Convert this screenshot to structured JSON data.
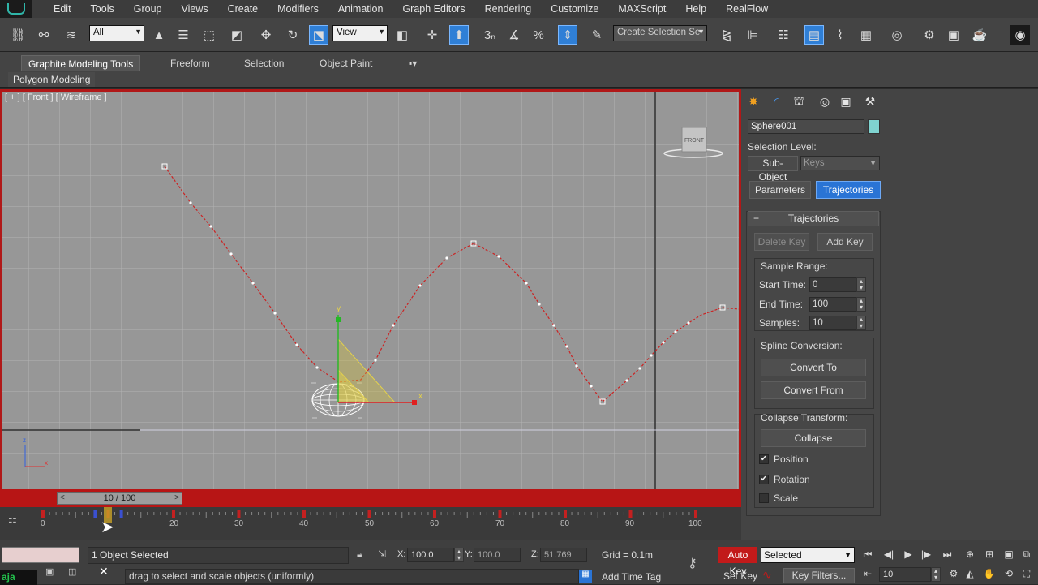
{
  "menubar": {
    "items": [
      "Edit",
      "Tools",
      "Group",
      "Views",
      "Create",
      "Modifiers",
      "Animation",
      "Graph Editors",
      "Rendering",
      "Customize",
      "MAXScript",
      "Help",
      "RealFlow"
    ]
  },
  "toolbar": {
    "selection_filter": "All",
    "reference_coord": "View",
    "named_selection_placeholder": "Create Selection Se"
  },
  "ribbon": {
    "tabs": [
      "Graphite Modeling Tools",
      "Freeform",
      "Selection",
      "Object Paint"
    ],
    "active_tab": "Graphite Modeling Tools",
    "sub_label": "Polygon Modeling"
  },
  "viewport": {
    "label": "[ + ] [ Front ] [ Wireframe ]",
    "viewcube_label": "FRONT",
    "gizmo_y": "y",
    "gizmo_x": "x",
    "axis_z": "z",
    "axis_x": "x"
  },
  "timeline": {
    "frame_display": "10 / 100",
    "current_frame": 10,
    "total_frames": 100,
    "ticks": [
      "0",
      "20",
      "30",
      "40",
      "50",
      "60",
      "70",
      "80",
      "90",
      "100"
    ]
  },
  "status": {
    "selection_text": "1 Object Selected",
    "prompt_text": "drag to select and scale objects (uniformly)",
    "badge": "aja",
    "x_label": "X:",
    "x_value": "100.0",
    "y_label": "Y:",
    "y_value": "100.0",
    "z_label": "Z:",
    "z_value": "51.769",
    "grid": "Grid = 0.1m",
    "add_time_tag": "Add Time Tag",
    "auto_key": "Auto Key",
    "key_mode": "Selected",
    "set_key": "Set Key",
    "key_filters": "Key Filters...",
    "frame_value": "10"
  },
  "command_panel": {
    "object_name": "Sphere001",
    "object_color": "#7fd3d0",
    "selection_level_label": "Selection Level:",
    "sub_object_label": "Sub-Object",
    "sub_object_value": "Keys",
    "tab_parameters": "Parameters",
    "tab_trajectories": "Trajectories",
    "rollout_title": "Trajectories",
    "delete_key": "Delete Key",
    "add_key": "Add Key",
    "sample_range": "Sample Range:",
    "start_time_label": "Start Time:",
    "start_time": "0",
    "end_time_label": "End Time:",
    "end_time": "100",
    "samples_label": "Samples:",
    "samples": "10",
    "spline_conversion": "Spline Conversion:",
    "convert_to": "Convert To",
    "convert_from": "Convert From",
    "collapse_transform": "Collapse Transform:",
    "collapse": "Collapse",
    "position_label": "Position",
    "position_checked": true,
    "rotation_label": "Rotation",
    "rotation_checked": true,
    "scale_label": "Scale",
    "scale_checked": false
  },
  "colors": {
    "accent_blue": "#2a74d5",
    "trajectory": "#cc2222",
    "time_slider": "#b71515",
    "auto_key": "#c21a1a"
  }
}
